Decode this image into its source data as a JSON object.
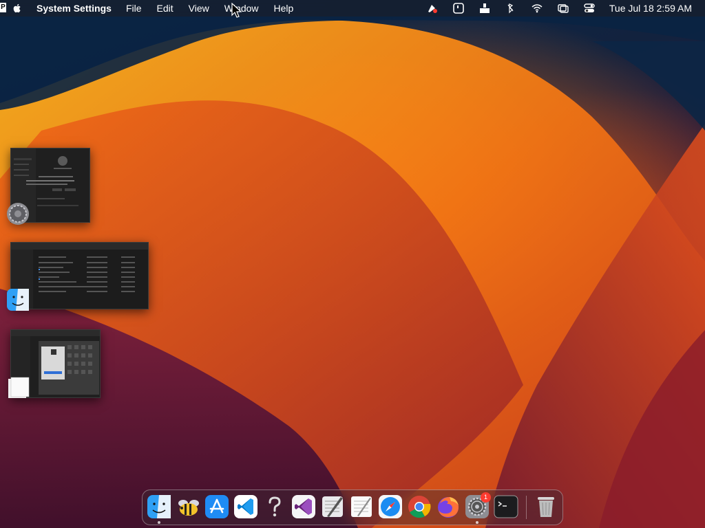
{
  "menubar": {
    "app_name": "System Settings",
    "menus": [
      "File",
      "Edit",
      "View",
      "Window",
      "Help"
    ],
    "clock": "Tue Jul 18  2:59 AM",
    "corner_letter": "P",
    "status_icons": [
      "pen-tool-icon",
      "square-app-icon",
      "upload-tray-icon",
      "bluetooth-off-icon",
      "wifi-icon",
      "screen-mirroring-icon",
      "control-center-icon"
    ]
  },
  "windows": [
    {
      "app": "System Settings",
      "icon": "gear-icon"
    },
    {
      "app": "Finder",
      "icon": "finder-icon"
    },
    {
      "app": "Preview",
      "icon": "preview-icon"
    }
  ],
  "dock": {
    "items": [
      {
        "name": "Finder",
        "icon": "finder-icon",
        "running": true
      },
      {
        "name": "Cyberduck",
        "icon": "bee-icon",
        "running": false
      },
      {
        "name": "App Store",
        "icon": "app-store-icon",
        "running": false
      },
      {
        "name": "Visual Studio Code",
        "icon": "vscode-icon",
        "running": false
      },
      {
        "name": "Help",
        "icon": "question-mark-icon",
        "running": false
      },
      {
        "name": "Visual Studio",
        "icon": "visual-studio-icon",
        "running": false
      },
      {
        "name": "Script Editor",
        "icon": "script-editor-icon",
        "running": false
      },
      {
        "name": "TextEdit",
        "icon": "textedit-icon",
        "running": false
      },
      {
        "name": "Safari",
        "icon": "safari-icon",
        "running": false
      },
      {
        "name": "Chrome",
        "icon": "chrome-icon",
        "running": false
      },
      {
        "name": "Firefox",
        "icon": "firefox-icon",
        "running": false
      },
      {
        "name": "System Settings",
        "icon": "gear-icon",
        "running": true,
        "badge": "1"
      },
      {
        "name": "Terminal",
        "icon": "terminal-icon",
        "running": false
      },
      {
        "name": "Trash",
        "icon": "trash-icon",
        "running": false
      }
    ]
  }
}
